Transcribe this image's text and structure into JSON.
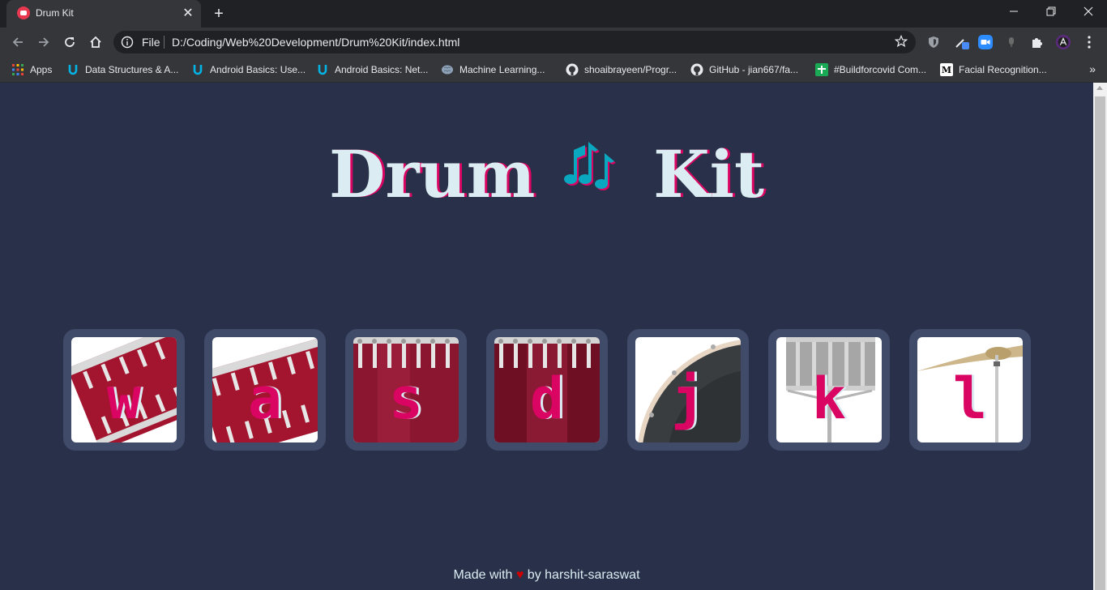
{
  "browser": {
    "tab_title": "Drum Kit",
    "tab_close": "✕",
    "new_tab": "+",
    "window_controls": {
      "minimize": "—",
      "restore": "❐",
      "close": "✕"
    },
    "url_scheme": "File",
    "url": "D:/Coding/Web%20Development/Drum%20Kit/index.html"
  },
  "bookmarks": {
    "apps_label": "Apps",
    "items": [
      {
        "label": "Data Structures & A...",
        "icon": "udacity-icon"
      },
      {
        "label": "Android Basics: Use...",
        "icon": "udacity-icon"
      },
      {
        "label": "Android Basics: Net...",
        "icon": "udacity-icon"
      },
      {
        "label": "Machine Learning...",
        "icon": "brain-icon"
      },
      {
        "label": "shoaibrayeen/Progr...",
        "icon": "github-icon"
      },
      {
        "label": "GitHub - jian667/fa...",
        "icon": "github-icon"
      },
      {
        "label": "#Buildforcovid Com...",
        "icon": "devpost-icon"
      },
      {
        "label": "Facial Recognition...",
        "icon": "medium-icon",
        "glyph": "M"
      }
    ],
    "more": "»"
  },
  "page": {
    "title_left": "Drum",
    "title_right": "Kit",
    "keys": [
      {
        "letter": "w",
        "instrument": "tom-1"
      },
      {
        "letter": "a",
        "instrument": "tom-2"
      },
      {
        "letter": "s",
        "instrument": "tom-3"
      },
      {
        "letter": "d",
        "instrument": "tom-4"
      },
      {
        "letter": "j",
        "instrument": "snare"
      },
      {
        "letter": "k",
        "instrument": "crash"
      },
      {
        "letter": "l",
        "instrument": "kick-cymbal"
      }
    ],
    "footer": {
      "prefix": "Made with",
      "heart": "♥",
      "suffix": "by harshit-saraswat"
    }
  },
  "colors": {
    "page_bg": "#283149",
    "key_bg": "#404b69",
    "accent_pink": "#da0463",
    "text_light": "#dbedf3",
    "note_teal": "#0aa8c0"
  }
}
